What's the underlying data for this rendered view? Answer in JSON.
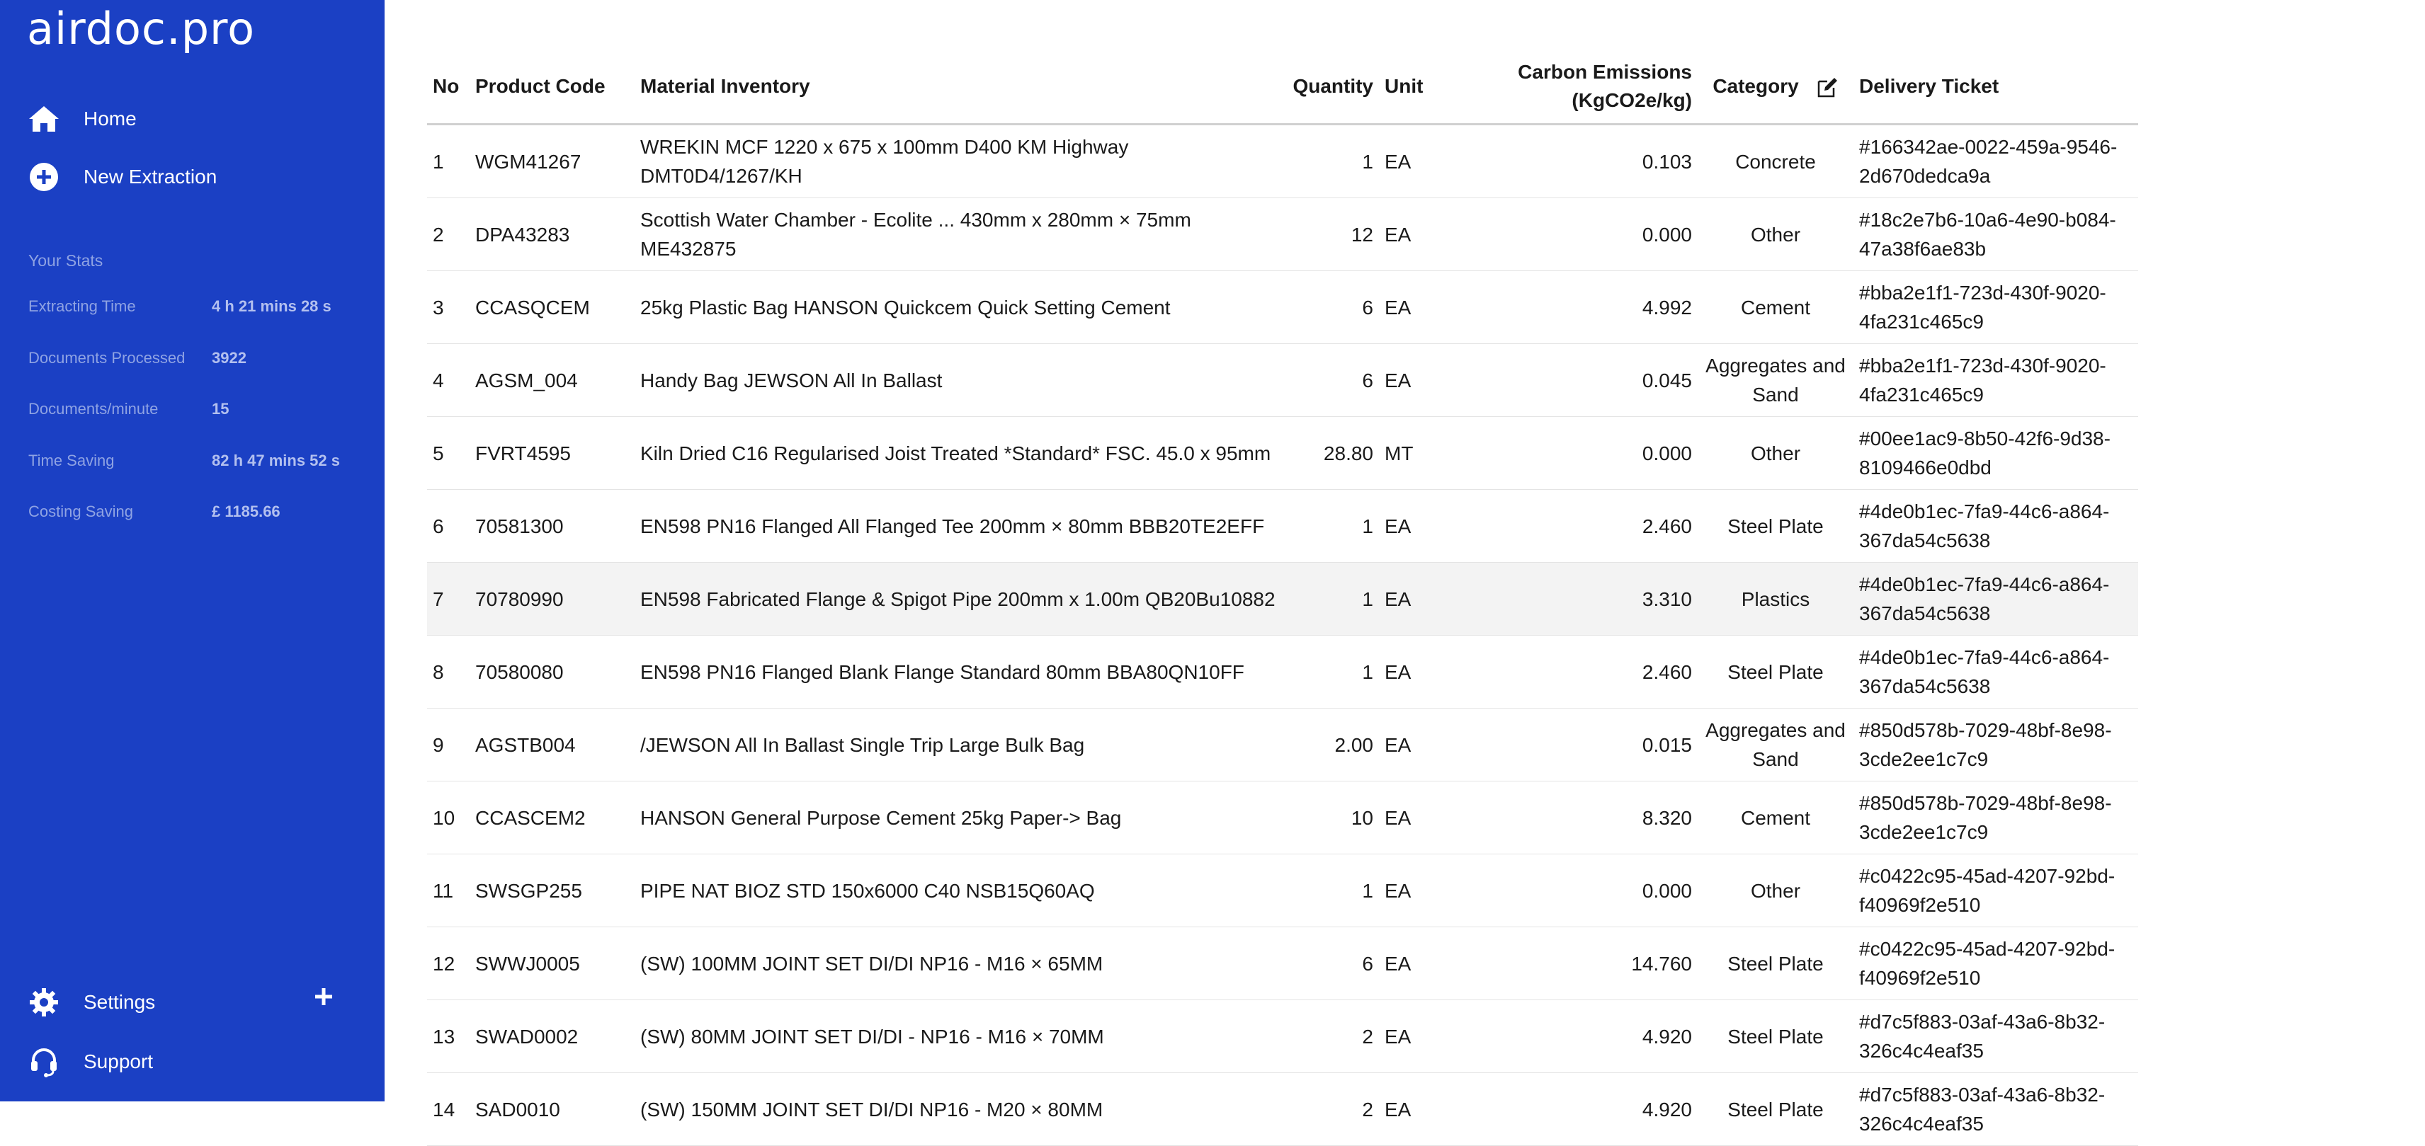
{
  "app": {
    "logo": "airdoc.pro"
  },
  "nav": {
    "home": "Home",
    "new_extraction": "New Extraction",
    "settings": "Settings",
    "support": "Support"
  },
  "stats": {
    "title": "Your Stats",
    "items": [
      {
        "label": "Extracting Time",
        "value": "4 h 21 mins 28 s"
      },
      {
        "label": "Documents Processed",
        "value": "3922"
      },
      {
        "label": "Documents/minute",
        "value": "15"
      },
      {
        "label": "Time Saving",
        "value": "82 h 47 mins 52 s"
      },
      {
        "label": "Costing Saving",
        "value": "£ 1185.66"
      }
    ]
  },
  "table": {
    "headers": {
      "no": "No",
      "product_code": "Product Code",
      "material": "Material Inventory",
      "quantity": "Quantity",
      "unit": "Unit",
      "carbon_line1": "Carbon Emissions",
      "carbon_line2": "(KgCO2e/kg)",
      "category": "Category",
      "ticket": "Delivery Ticket"
    },
    "rows": [
      {
        "no": "1",
        "code": "WGM41267",
        "material": "WREKIN MCF 1220 x 675 x 100mm D400 KM Highway DMT0D4/1267/KH",
        "qty": "1",
        "unit": "EA",
        "carbon": "0.103",
        "category": "Concrete",
        "ticket": "#166342ae-0022-459a-9546-2d670dedca9a"
      },
      {
        "no": "2",
        "code": "DPA43283",
        "material": "Scottish Water Chamber - Ecolite ... 430mm x 280mm × 75mm ME432875",
        "qty": "12",
        "unit": "EA",
        "carbon": "0.000",
        "category": "Other",
        "ticket": "#18c2e7b6-10a6-4e90-b084-47a38f6ae83b"
      },
      {
        "no": "3",
        "code": "CCASQCEM",
        "material": "25kg Plastic Bag HANSON Quickcem Quick Setting Cement",
        "qty": "6",
        "unit": "EA",
        "carbon": "4.992",
        "category": "Cement",
        "ticket": "#bba2e1f1-723d-430f-9020-4fa231c465c9"
      },
      {
        "no": "4",
        "code": "AGSM_004",
        "material": "Handy Bag JEWSON All In Ballast",
        "qty": "6",
        "unit": "EA",
        "carbon": "0.045",
        "category": "Aggregates and Sand",
        "ticket": "#bba2e1f1-723d-430f-9020-4fa231c465c9"
      },
      {
        "no": "5",
        "code": "FVRT4595",
        "material": "Kiln Dried C16 Regularised Joist Treated *Standard* FSC. 45.0 x 95mm",
        "qty": "28.80",
        "unit": "MT",
        "carbon": "0.000",
        "category": "Other",
        "ticket": "#00ee1ac9-8b50-42f6-9d38-8109466e0dbd"
      },
      {
        "no": "6",
        "code": "70581300",
        "material": "EN598 PN16 Flanged All Flanged Tee 200mm × 80mm BBB20TE2EFF",
        "qty": "1",
        "unit": "EA",
        "carbon": "2.460",
        "category": "Steel Plate",
        "ticket": "#4de0b1ec-7fa9-44c6-a864-367da54c5638"
      },
      {
        "no": "7",
        "code": "70780990",
        "material": "EN598 Fabricated Flange & Spigot Pipe 200mm x 1.00m QB20Bu10882",
        "qty": "1",
        "unit": "EA",
        "carbon": "3.310",
        "category": "Plastics",
        "ticket": "#4de0b1ec-7fa9-44c6-a864-367da54c5638"
      },
      {
        "no": "8",
        "code": "70580080",
        "material": "EN598 PN16 Flanged Blank Flange Standard 80mm BBA80QN10FF",
        "qty": "1",
        "unit": "EA",
        "carbon": "2.460",
        "category": "Steel Plate",
        "ticket": "#4de0b1ec-7fa9-44c6-a864-367da54c5638"
      },
      {
        "no": "9",
        "code": "AGSTB004",
        "material": "/JEWSON All In Ballast Single Trip Large Bulk Bag",
        "qty": "2.00",
        "unit": "EA",
        "carbon": "0.015",
        "category": "Aggregates and Sand",
        "ticket": "#850d578b-7029-48bf-8e98-3cde2ee1c7c9"
      },
      {
        "no": "10",
        "code": "CCASCEM2",
        "material": "HANSON General Purpose Cement 25kg Paper-> Bag",
        "qty": "10",
        "unit": "EA",
        "carbon": "8.320",
        "category": "Cement",
        "ticket": "#850d578b-7029-48bf-8e98-3cde2ee1c7c9"
      },
      {
        "no": "11",
        "code": "SWSGP255",
        "material": "PIPE NAT BIOZ STD 150x6000 C40 NSB15Q60AQ",
        "qty": "1",
        "unit": "EA",
        "carbon": "0.000",
        "category": "Other",
        "ticket": "#c0422c95-45ad-4207-92bd-f40969f2e510"
      },
      {
        "no": "12",
        "code": "SWWJ0005",
        "material": "(SW) 100MM JOINT SET DI/DI NP16 - M16 × 65MM",
        "qty": "6",
        "unit": "EA",
        "carbon": "14.760",
        "category": "Steel Plate",
        "ticket": "#c0422c95-45ad-4207-92bd-f40969f2e510"
      },
      {
        "no": "13",
        "code": "SWAD0002",
        "material": "(SW) 80MM JOINT SET DI/DI - NP16 - M16 × 70MM",
        "qty": "2",
        "unit": "EA",
        "carbon": "4.920",
        "category": "Steel Plate",
        "ticket": "#d7c5f883-03af-43a6-8b32-326c4c4eaf35"
      },
      {
        "no": "14",
        "code": "SAD0010",
        "material": "(SW) 150MM JOINT SET DI/DI NP16 - M20 × 80MM",
        "qty": "2",
        "unit": "EA",
        "carbon": "4.920",
        "category": "Steel Plate",
        "ticket": "#d7c5f883-03af-43a6-8b32-326c4c4eaf35"
      }
    ]
  }
}
